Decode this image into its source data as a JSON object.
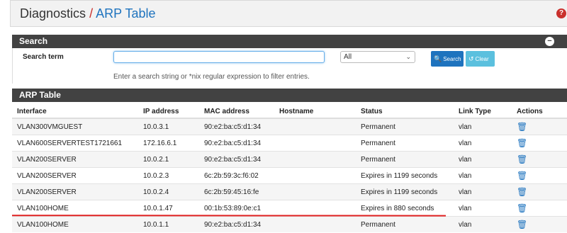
{
  "header": {
    "title": "Diagnostics",
    "separator": "/",
    "crumb": "ARP Table",
    "help_icon": "question-circle-icon"
  },
  "search_panel": {
    "title": "Search",
    "collapse_icon": "minus-circle-icon",
    "label": "Search term",
    "input_value": "",
    "select_value": "All",
    "search_button": "Search",
    "clear_button": "Clear",
    "hint": "Enter a search string or *nix regular expression to filter entries."
  },
  "arp_panel": {
    "title": "ARP Table",
    "columns": [
      "Interface",
      "IP address",
      "MAC address",
      "Hostname",
      "Status",
      "Link Type",
      "Actions"
    ],
    "rows": [
      {
        "interface": "VLAN300VMGUEST",
        "ip": "10.0.3.1",
        "mac": "90:e2:ba:c5:d1:34",
        "hostname": "",
        "status": "Permanent",
        "link": "vlan"
      },
      {
        "interface": "VLAN600SERVERTEST1721661",
        "ip": "172.16.6.1",
        "mac": "90:e2:ba:c5:d1:34",
        "hostname": "",
        "status": "Permanent",
        "link": "vlan"
      },
      {
        "interface": "VLAN200SERVER",
        "ip": "10.0.2.1",
        "mac": "90:e2:ba:c5:d1:34",
        "hostname": "",
        "status": "Permanent",
        "link": "vlan"
      },
      {
        "interface": "VLAN200SERVER",
        "ip": "10.0.2.3",
        "mac": "6c:2b:59:3c:f6:02",
        "hostname": "",
        "status": "Expires in 1199 seconds",
        "link": "vlan"
      },
      {
        "interface": "VLAN200SERVER",
        "ip": "10.0.2.4",
        "mac": "6c:2b:59:45:16:fe",
        "hostname": "",
        "status": "Expires in 1199 seconds",
        "link": "vlan"
      },
      {
        "interface": "VLAN100HOME",
        "ip": "10.0.1.47",
        "mac": "00:1b:53:89:0e:c1",
        "hostname": "",
        "status": "Expires in 880 seconds",
        "link": "vlan"
      },
      {
        "interface": "VLAN100HOME",
        "ip": "10.0.1.1",
        "mac": "90:e2:ba:c5:d1:34",
        "hostname": "",
        "status": "Permanent",
        "link": "vlan"
      }
    ],
    "action_icon": "trash-icon"
  },
  "colors": {
    "accent": "#1e73be",
    "panel_header": "#424242",
    "annotation": "#e02020"
  }
}
